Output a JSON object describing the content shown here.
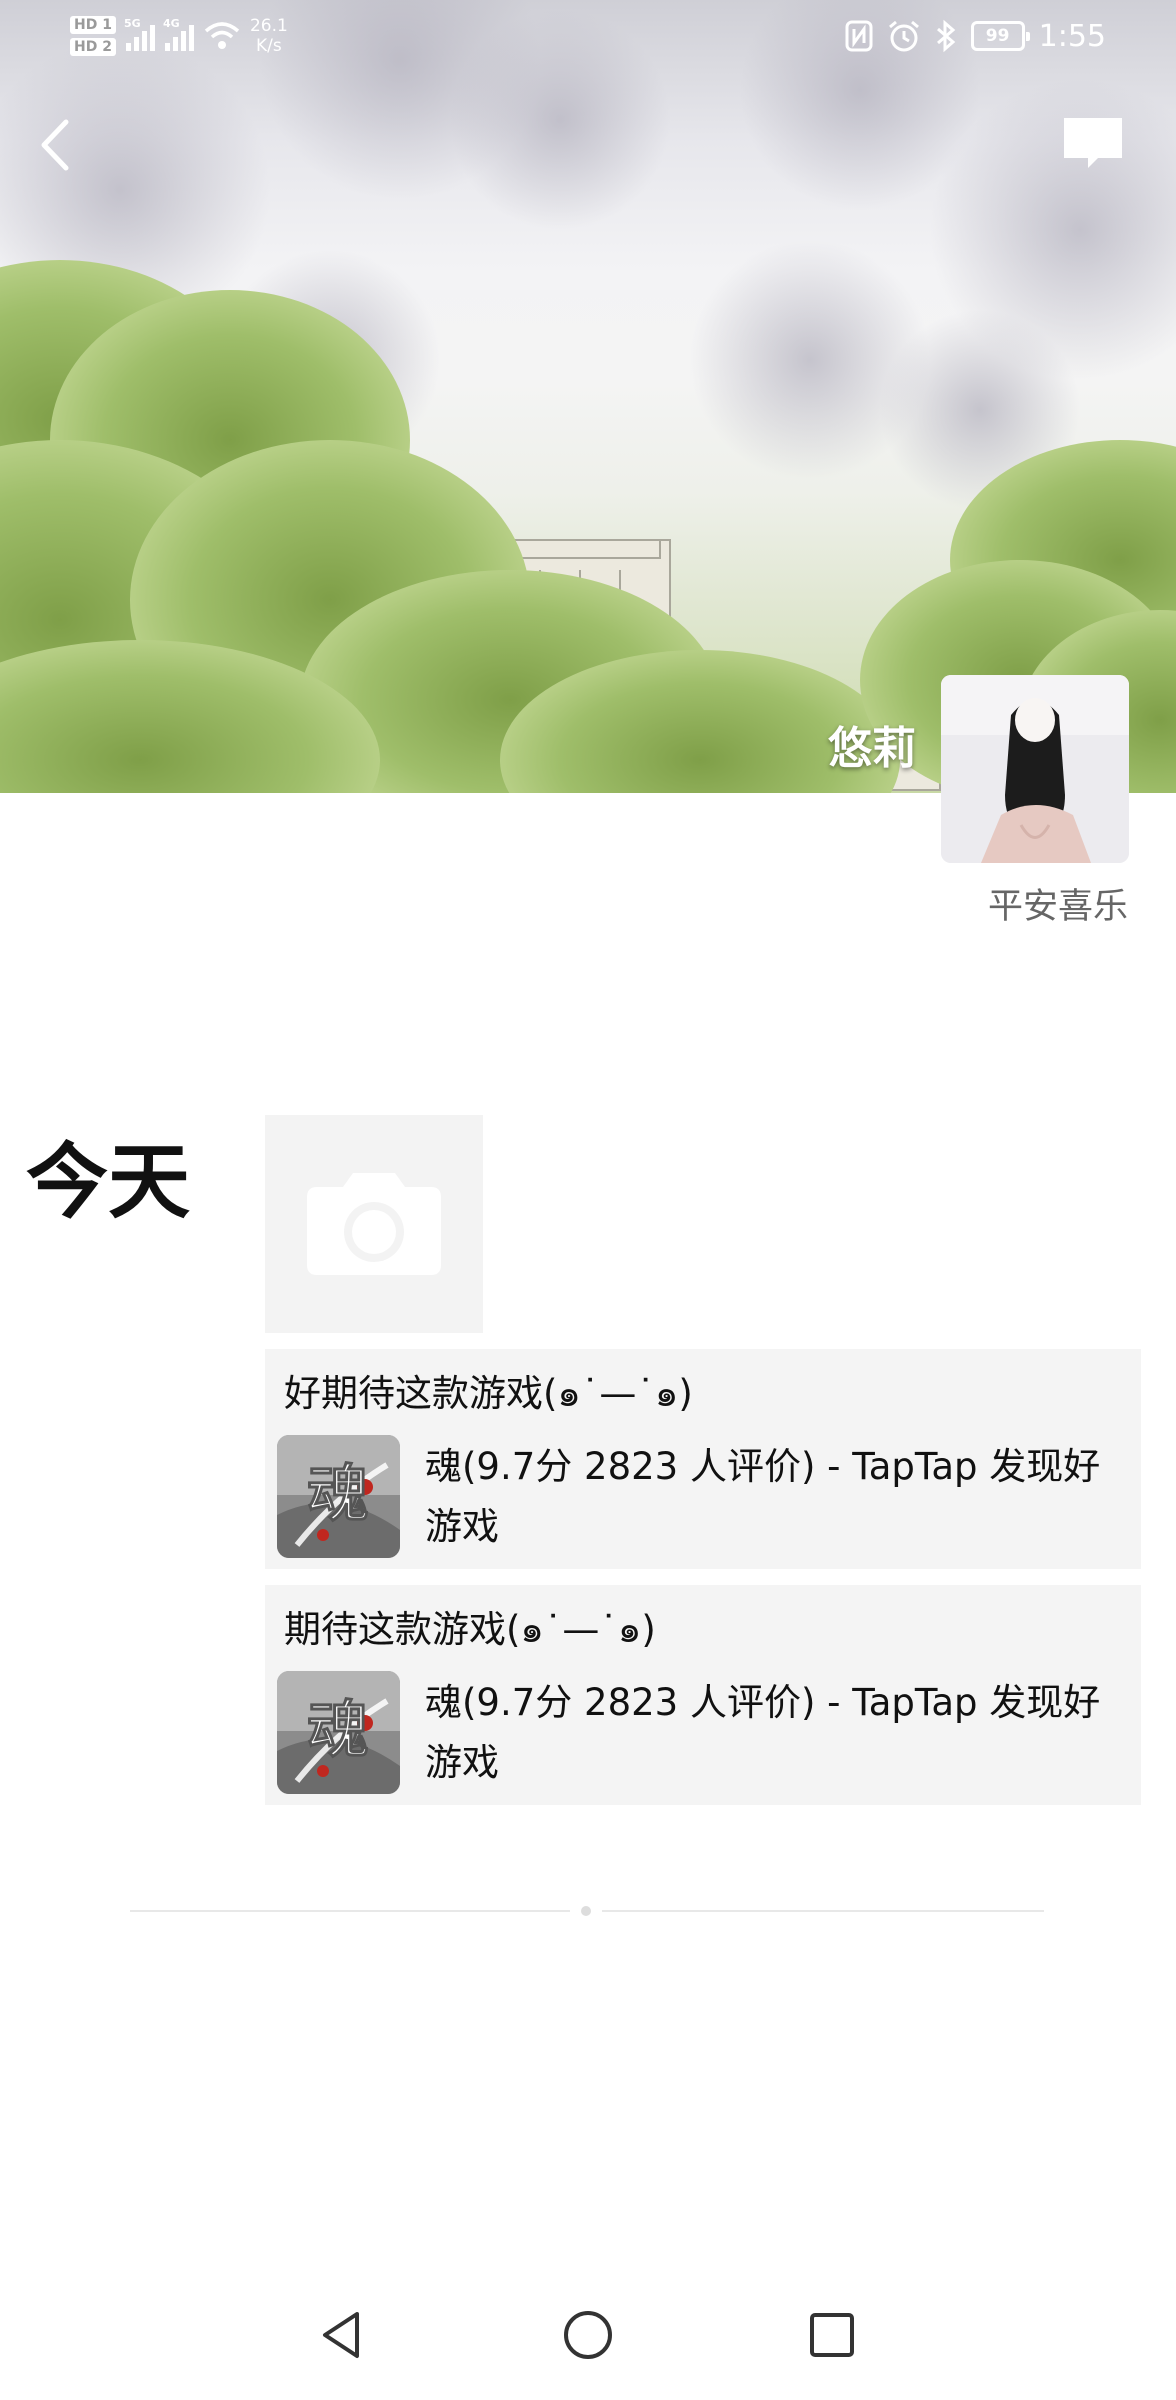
{
  "status_bar": {
    "sim1_badge": "HD 1",
    "sim2_badge": "HD 2",
    "sim1_network": "5G",
    "sim2_network": "4G",
    "net_speed_value": "26.1",
    "net_speed_unit": "K/s",
    "nfc_icon": "nfc-icon",
    "alarm_icon": "alarm-icon",
    "bluetooth_icon": "bluetooth-icon",
    "battery_level": "99",
    "time": "1:55"
  },
  "header": {
    "back_icon": "chevron-left-icon",
    "comment_icon": "speech-bubble-icon"
  },
  "profile": {
    "nickname": "悠莉",
    "signature": "平安喜乐"
  },
  "feed": {
    "day_label": "今天",
    "camera_icon": "camera-icon",
    "posts": [
      {
        "text": "好期待这款游戏(๑˙—˙๑)",
        "share_title": "魂(9.7分 2823 人评价) - TapTap 发现好游戏",
        "thumb_glyph": "魂"
      },
      {
        "text": "期待这款游戏(๑˙—˙๑)",
        "share_title": "魂(9.7分 2823 人评价) - TapTap 发现好游戏",
        "thumb_glyph": "魂"
      }
    ]
  },
  "nav_bar": {
    "back_icon": "triangle-back-icon",
    "home_icon": "circle-home-icon",
    "recents_icon": "square-recents-icon"
  },
  "colors": {
    "tree_green": "#9fbe6a",
    "card_bg": "#f4f4f4",
    "signature_gray": "#666666"
  }
}
